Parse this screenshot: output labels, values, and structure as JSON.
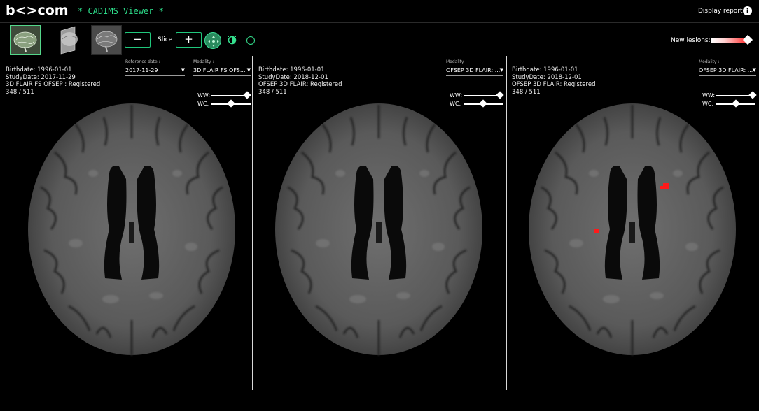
{
  "header": {
    "logo": "b<>com",
    "app_title": "* CADIMS Viewer *",
    "display_report": "Display report",
    "info_icon": "info-icon"
  },
  "toolbar": {
    "slice_minus": "−",
    "slice_label": "Slice",
    "slice_plus": "+",
    "tools": [
      "move-icon",
      "contrast-icon",
      "circle-icon"
    ],
    "new_lesions_label": "New lesions:",
    "new_lesions_colors": [
      "#ffffff",
      "#ff2020"
    ]
  },
  "panels": [
    {
      "birthdate": "Birthdate: 1996-01-01",
      "study_date": "StudyDate: 2017-11-29",
      "series": "3D FLAIR FS OFSEP : Registered",
      "slice_count": "348 / 511",
      "reference_date_label": "Reference date :",
      "reference_date_value": "2017-11-29",
      "modality_label": "Modality :",
      "modality_value": "3D FLAIR FS OFS...",
      "ww_label": "WW:",
      "wc_label": "WC:",
      "ww_level": 0.92,
      "wc_level": 0.52
    },
    {
      "birthdate": "Birthdate: 1996-01-01",
      "study_date": "StudyDate: 2018-12-01",
      "series": "OFSEP 3D FLAIR: Registered",
      "slice_count": "348 / 511",
      "modality_label": "Modality :",
      "modality_value": "OFSEP 3D FLAIR: ...",
      "ww_label": "WW:",
      "wc_label": "WC:",
      "ww_level": 0.92,
      "wc_level": 0.52
    },
    {
      "birthdate": "Birthdate: 1996-01-01",
      "study_date": "StudyDate: 2018-12-01",
      "series": "OFSEP 3D FLAIR: Registered",
      "slice_count": "348 / 511",
      "modality_label": "Modality :",
      "modality_value": "OFSEP 3D FLAIR: ...",
      "ww_label": "WW:",
      "wc_label": "WC:",
      "ww_level": 0.92,
      "wc_level": 0.52
    }
  ],
  "colors": {
    "accent": "#20c77c",
    "lesion": "#ff1a1a"
  }
}
